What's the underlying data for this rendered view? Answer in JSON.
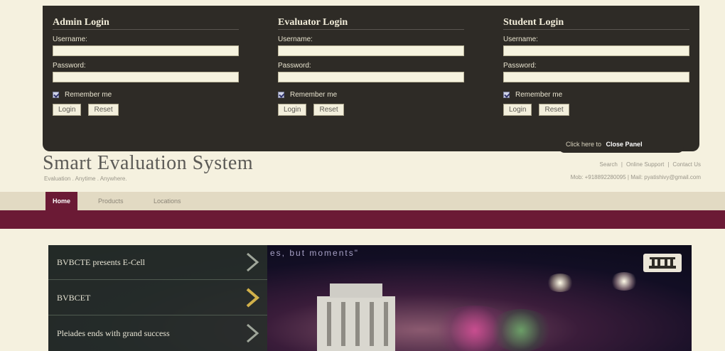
{
  "login_panel": {
    "columns": [
      {
        "title": "Admin Login",
        "username_label": "Username:",
        "password_label": "Password:",
        "remember_label": "Remember me",
        "login_button": "Login",
        "reset_button": "Reset"
      },
      {
        "title": "Evaluator Login",
        "username_label": "Username:",
        "password_label": "Password:",
        "remember_label": "Remember me",
        "login_button": "Login",
        "reset_button": "Reset"
      },
      {
        "title": "Student Login",
        "username_label": "Username:",
        "password_label": "Password:",
        "remember_label": "Remember me",
        "login_button": "Login",
        "reset_button": "Reset"
      }
    ],
    "close_prefix": "Click here to",
    "close_label": "Close Panel"
  },
  "header": {
    "title": "Smart Evaluation System",
    "tagline": "Evaluation . Anytime . Anywhere.",
    "links": [
      "Search",
      "Online Support",
      "Contact Us"
    ],
    "contact": "Mob: +918892280095 | Mail: pyatishivy@gmail.com"
  },
  "nav": {
    "items": [
      "Home",
      "Products",
      "Locations"
    ],
    "active": "Home"
  },
  "banner": {
    "quote": "es, but moments\"",
    "slides": [
      "BVBCTE presents E-Cell",
      "BVBCET",
      "Pleiades ends with grand success"
    ]
  },
  "colors": {
    "panel": "#2e2b26",
    "accent": "#6b1a35",
    "background": "#f5f1df"
  }
}
